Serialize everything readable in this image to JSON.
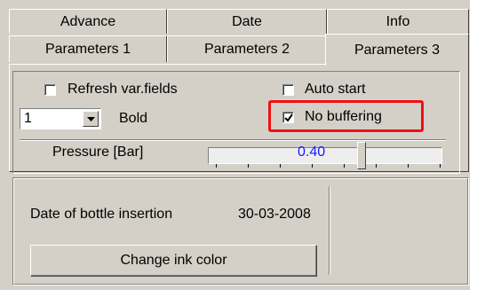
{
  "tabs": {
    "row1": [
      "Advance",
      "Date",
      "Info"
    ],
    "row2": [
      "Parameters 1",
      "Parameters 2",
      "Parameters 3"
    ],
    "active": "Parameters 3"
  },
  "options": {
    "refresh_var_fields": {
      "label": "Refresh var.fields",
      "checked": false
    },
    "auto_start": {
      "label": "Auto start",
      "checked": false
    },
    "no_buffering": {
      "label": "No buffering",
      "checked": true
    },
    "bold_label": "Bold",
    "size_combo_value": "1"
  },
  "pressure": {
    "label": "Pressure [Bar]",
    "value_text": "0.40"
  },
  "bottle": {
    "label": "Date of bottle insertion",
    "date": "30-03-2008"
  },
  "buttons": {
    "change_ink_color": "Change ink color"
  },
  "icons": {
    "combo_arrow": "chevron-down-icon",
    "check": "checkmark-icon"
  },
  "colors": {
    "highlight": "#ee1111",
    "slider_value": "#1a1aff"
  }
}
